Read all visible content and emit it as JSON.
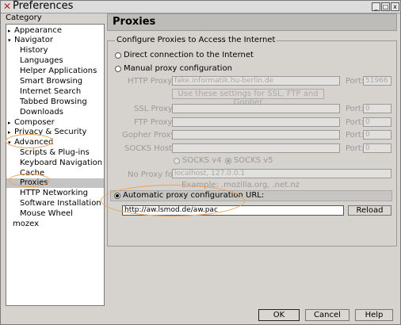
{
  "window": {
    "title": "Preferences",
    "minimize": "_",
    "maximize": "□",
    "close": "x"
  },
  "sidebar": {
    "label": "Category",
    "items": [
      {
        "label": "Appearance",
        "twisty": "▸"
      },
      {
        "label": "Navigator",
        "twisty": "▾"
      },
      {
        "label": "History"
      },
      {
        "label": "Languages"
      },
      {
        "label": "Helper Applications"
      },
      {
        "label": "Smart Browsing"
      },
      {
        "label": "Internet Search"
      },
      {
        "label": "Tabbed Browsing"
      },
      {
        "label": "Downloads"
      },
      {
        "label": "Composer",
        "twisty": "▸"
      },
      {
        "label": "Privacy & Security",
        "twisty": "▸"
      },
      {
        "label": "Advanced",
        "twisty": "▾"
      },
      {
        "label": "Scripts & Plug-ins"
      },
      {
        "label": "Keyboard Navigation"
      },
      {
        "label": "Cache"
      },
      {
        "label": "Proxies"
      },
      {
        "label": "HTTP Networking"
      },
      {
        "label": "Software Installation"
      },
      {
        "label": "Mouse Wheel"
      },
      {
        "label": "mozex"
      }
    ]
  },
  "panel": {
    "title": "Proxies",
    "group_label": "Configure Proxies to Access the Internet",
    "direct": "Direct connection to the Internet",
    "manual": "Manual proxy configuration",
    "http_label": "HTTP Proxy:",
    "http_value": "fake.informatik.hu-berlin.de",
    "port_label": "Port:",
    "http_port": "51966",
    "same_settings": "Use these settings for SSL, FTP and Gopher",
    "ssl_label": "SSL Proxy:",
    "ftp_label": "FTP Proxy:",
    "gopher_label": "Gopher Proxy:",
    "socks_label": "SOCKS Host:",
    "zero_port": "0",
    "socks4": "SOCKS v4",
    "socks5": "SOCKS v5",
    "noproxy_label": "No Proxy for:",
    "noproxy_value": "localhost, 127.0.0.1",
    "example": "Example: .mozilla.org, .net.nz",
    "auto": "Automatic proxy configuration URL:",
    "auto_url": "http://aw.lsmod.de/aw.pac",
    "reload": "Reload"
  },
  "footer": {
    "ok": "OK",
    "cancel": "Cancel",
    "help": "Help"
  },
  "annotation_color": "#f0a050"
}
